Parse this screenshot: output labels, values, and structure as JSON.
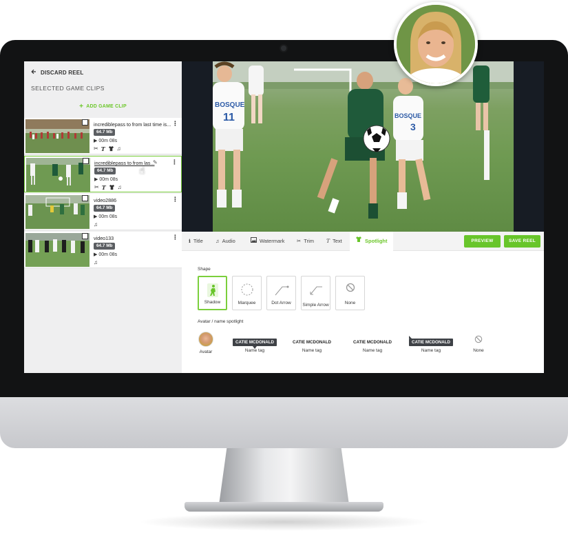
{
  "sidebar": {
    "discard_label": "DISCARD REEL",
    "section_title": "SELECTED GAME CLIPS",
    "add_clip_label": "ADD GAME CLIP",
    "clips": [
      {
        "name": "incrediblepass to from last time is...",
        "size": "64.7 Mb",
        "duration": "00m 08s",
        "tools": [
          "scissors-icon",
          "text-icon",
          "jersey-icon",
          "music-icon"
        ]
      },
      {
        "name": "incrediblepass to from las...",
        "size": "64.7 Mb",
        "duration": "00m 08s",
        "tools": [
          "scissors-icon",
          "text-icon",
          "jersey-icon",
          "music-icon"
        ],
        "active": true
      },
      {
        "name": "video2886",
        "size": "64.7 Mb",
        "duration": "00m 08s",
        "tools": [
          "music-icon"
        ]
      },
      {
        "name": "video133",
        "size": "64.7 Mb",
        "duration": "00m 08s",
        "tools": [
          "music-icon"
        ]
      }
    ]
  },
  "toolbar": {
    "tabs": [
      {
        "label": "Title",
        "icon": "info-icon"
      },
      {
        "label": "Audio",
        "icon": "music-icon"
      },
      {
        "label": "Watermark",
        "icon": "image-icon"
      },
      {
        "label": "Trim",
        "icon": "scissors-icon"
      },
      {
        "label": "Text",
        "icon": "text-icon"
      },
      {
        "label": "Spotlight",
        "icon": "jersey-icon",
        "active": true
      }
    ],
    "preview_label": "PREVIEW",
    "save_label": "SAVE REEL"
  },
  "spotlight": {
    "shape_title": "Shape",
    "shapes": [
      {
        "label": "Shadow",
        "icon": "player-shadow-icon",
        "selected": true
      },
      {
        "label": "Marquee",
        "icon": "dashed-circle-icon"
      },
      {
        "label": "Dot Arrow",
        "icon": "dot-arrow-icon"
      },
      {
        "label": "Simple Arrow",
        "icon": "simple-arrow-icon"
      },
      {
        "label": "None",
        "icon": "none-icon"
      }
    ],
    "avatar_title": "Avatar / name spotlight",
    "options": [
      {
        "label": "Avatar",
        "type": "avatar"
      },
      {
        "label": "Name tag",
        "tag": "CATIE MCDONALD"
      },
      {
        "label": "Name tag",
        "tag": "CATIE MCDONALD"
      },
      {
        "label": "Name tag",
        "tag": "CATIE MCDONALD"
      },
      {
        "label": "Name tag",
        "tag": "CATIE MCDONALD"
      },
      {
        "label": "None",
        "type": "none"
      }
    ]
  },
  "video": {
    "jersey_left": "BOSQUE",
    "number_left": "11",
    "jersey_right": "BOSQUE",
    "number_right": "3"
  },
  "colors": {
    "accent": "#68c52a",
    "bezel": "#121314",
    "sidebar": "#efeff0"
  }
}
